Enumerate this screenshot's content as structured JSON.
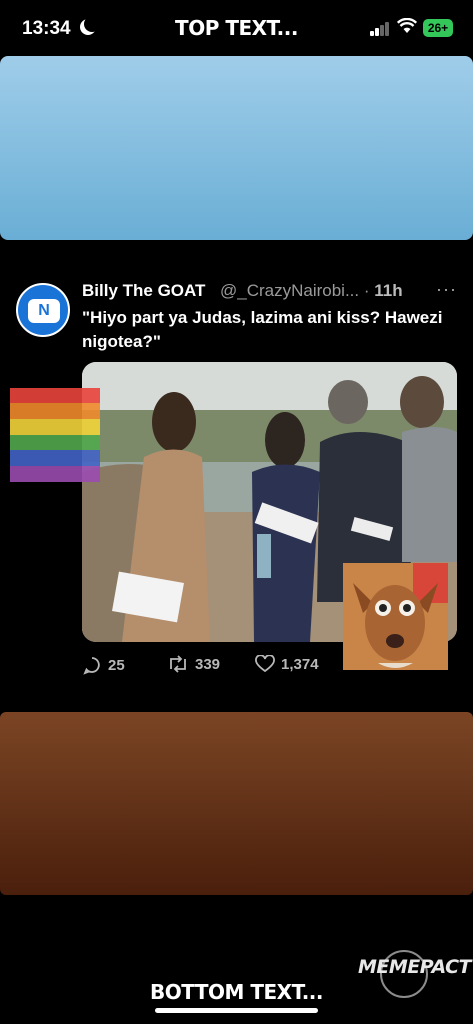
{
  "status_bar": {
    "time": "13:34",
    "battery": "26+",
    "title": "TOP TEXT..."
  },
  "tweet": {
    "display_name": "Billy The GOAT",
    "handle": "@_CrazyNairobi...",
    "age": "11h",
    "text": "\"Hiyo part ya Judas, lazima ani kiss? Hawezi nigotea?\"",
    "replies": "25",
    "retweets": "339",
    "likes": "1,374"
  },
  "bottom_text": "BOTTOM TEXT...",
  "watermark": "MEMEPACT",
  "colors": {
    "top_panel": "#7fbde0",
    "bottom_panel": "#5e2f14",
    "avatar": "#1a74d8"
  }
}
